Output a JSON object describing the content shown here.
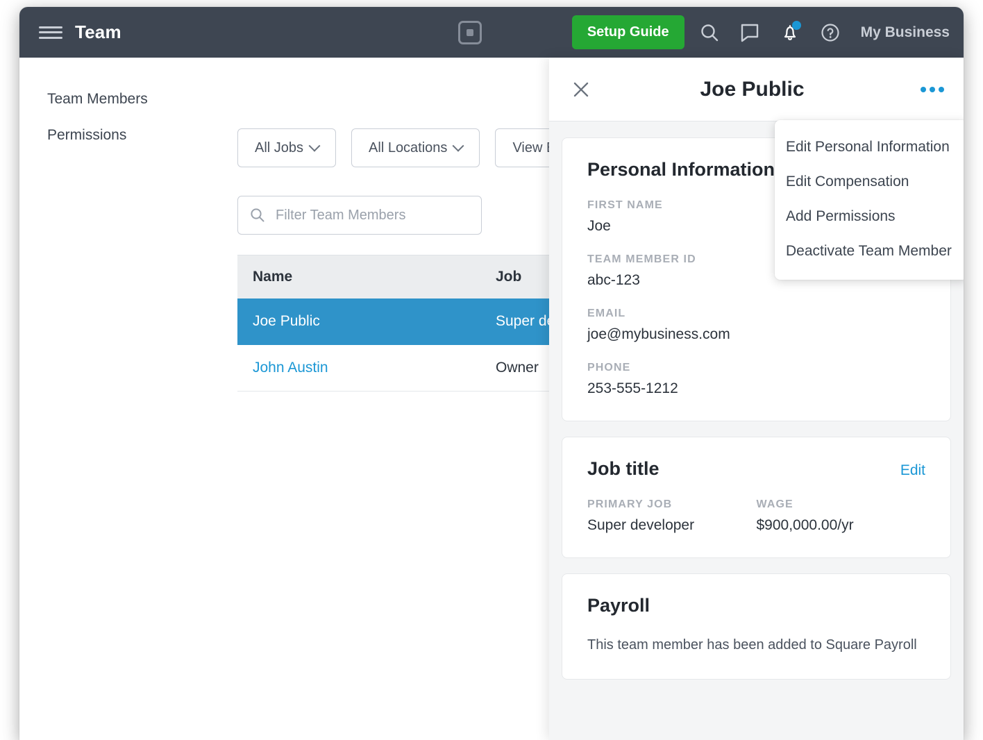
{
  "topnav": {
    "menu_icon": "hamburger-icon",
    "title": "Team",
    "logo_icon": "square-logo-icon",
    "setup_button": "Setup Guide",
    "search_icon": "search-icon",
    "messages_icon": "chat-bubble-icon",
    "notifications_icon": "bell-icon",
    "help_icon": "question-circle-icon",
    "business_name": "My Business",
    "brand_green": "#25a834",
    "bar_background": "#3e4652",
    "badge_blue": "#1b97d5"
  },
  "sidebar": {
    "items": [
      {
        "label": "Team Members"
      },
      {
        "label": "Permissions"
      }
    ]
  },
  "filters": {
    "buttons": [
      {
        "label": "All Jobs"
      },
      {
        "label": "All Locations"
      },
      {
        "label": "View By"
      }
    ]
  },
  "search": {
    "placeholder": "Filter Team Members",
    "value": ""
  },
  "table": {
    "columns": [
      "Name",
      "Job"
    ],
    "rows": [
      {
        "name": "Joe Public",
        "job": "Super developer",
        "selected": true
      },
      {
        "name": "John Austin",
        "job": "Owner",
        "selected": false
      }
    ],
    "selected_row_color": "#2f93c9",
    "header_background": "#ebedef"
  },
  "panel": {
    "close_icon": "close-x-icon",
    "title": "Joe Public",
    "more_icon": "kebab-more-icon",
    "personal": {
      "title": "Personal Information",
      "fields": [
        {
          "label": "First Name",
          "value": "Joe"
        },
        {
          "label": "Team Member ID",
          "value": "abc-123"
        },
        {
          "label": "Email",
          "value": "joe@mybusiness.com"
        },
        {
          "label": "Phone",
          "value": "253-555-1212"
        }
      ]
    },
    "job": {
      "title": "Job title",
      "edit_label": "Edit",
      "primary_job_label": "Primary Job",
      "primary_job_value": "Super developer",
      "wage_label": "Wage",
      "wage_value": "$900,000.00/yr"
    },
    "payroll": {
      "title": "Payroll",
      "note": "This team member has been added to Square Payroll"
    }
  },
  "dropdown": {
    "items": [
      {
        "label": "Edit Personal Information"
      },
      {
        "label": "Edit Compensation"
      },
      {
        "label": "Add Permissions"
      },
      {
        "label": "Deactivate Team Member"
      }
    ]
  }
}
